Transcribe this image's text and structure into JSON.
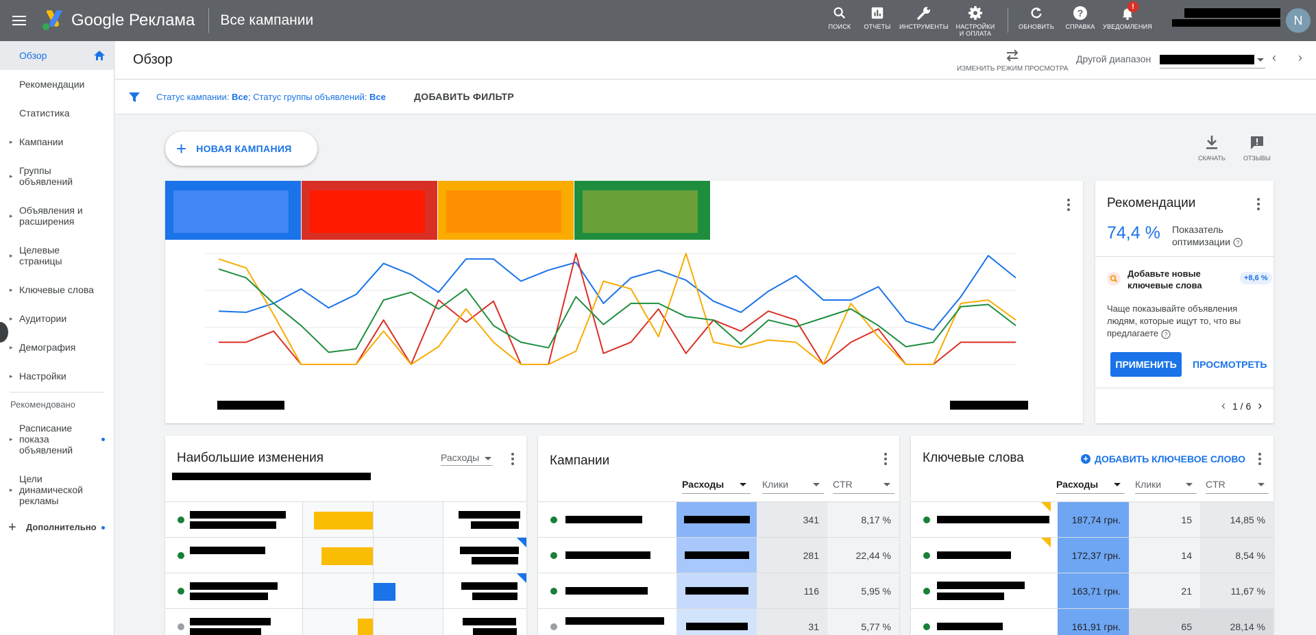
{
  "topbar": {
    "brand": "Google Реклама",
    "title": "Все кампании",
    "actions": [
      {
        "icon": "search-icon",
        "label": "ПОИСК"
      },
      {
        "icon": "reports-icon",
        "label": "ОТЧЕТЫ"
      },
      {
        "icon": "wrench-icon",
        "label": "ИНСТРУМЕНТЫ"
      },
      {
        "icon": "gear-icon",
        "label": "НАСТРОЙКИ И ОПЛАТА"
      },
      {
        "icon": "refresh-icon",
        "label": "ОБНОВИТЬ"
      },
      {
        "icon": "help-icon",
        "label": "СПРАВКА"
      },
      {
        "icon": "bell-icon",
        "label": "УВЕДОМЛЕНИЯ"
      }
    ],
    "notification_badge": "!",
    "avatar_letter": "N"
  },
  "sidebar": {
    "items": [
      {
        "label": "Обзор",
        "active": true
      },
      {
        "label": "Рекомендации"
      },
      {
        "label": "Статистика"
      },
      {
        "label": "Кампании"
      },
      {
        "label": "Группы объявлений"
      },
      {
        "label": "Объявления и расширения"
      },
      {
        "label": "Целевые страницы"
      },
      {
        "label": "Ключевые слова"
      },
      {
        "label": "Аудитории"
      },
      {
        "label": "Демография"
      },
      {
        "label": "Настройки"
      }
    ],
    "recommended_heading": "Рекомендовано",
    "recommended": [
      {
        "label": "Расписание показа объявлений"
      },
      {
        "label": "Цели динамической рекламы"
      }
    ],
    "more": "Дополнительно"
  },
  "header": {
    "title": "Обзор",
    "view_switch": "ИЗМЕНИТЬ РЕЖИМ ПРОСМОТРА",
    "range_label": "Другой диапазон"
  },
  "filter": {
    "campaign_status_label": "Статус кампании: ",
    "campaign_status_value": "Все",
    "sep": "; ",
    "group_status_label": "Статус группы объявлений: ",
    "group_status_value": "Все",
    "add_filter": "ДОБАВИТЬ ФИЛЬТР"
  },
  "new_campaign": "НОВАЯ КАМПАНИЯ",
  "utils": {
    "download": "СКАЧАТЬ",
    "feedback": "ОТЗЫВЫ"
  },
  "colors": {
    "blue": "#1a73e8",
    "red": "#d93025",
    "yellow": "#f9ab00",
    "green": "#1e8e3e"
  },
  "chart_data": {
    "type": "line",
    "series": [
      {
        "color": "#1a73e8",
        "values": [
          48,
          47,
          55,
          68,
          51,
          63,
          91,
          81,
          65,
          95,
          95,
          75,
          85,
          92,
          55,
          78,
          85,
          76,
          57,
          47,
          66,
          80,
          58,
          58,
          70,
          39,
          31,
          61,
          98,
          78
        ]
      },
      {
        "color": "#d93025",
        "values": [
          20,
          20,
          30,
          0,
          0,
          0,
          40,
          0,
          58,
          38,
          57,
          0,
          0,
          100,
          10,
          20,
          50,
          10,
          40,
          30,
          48,
          40,
          0,
          20,
          32,
          0,
          0,
          20,
          20,
          20
        ]
      },
      {
        "color": "#f9ab00",
        "values": [
          95,
          87,
          45,
          0,
          0,
          0,
          30,
          0,
          16,
          50,
          20,
          0,
          0,
          12,
          75,
          68,
          25,
          100,
          20,
          15,
          22,
          20,
          0,
          55,
          25,
          0,
          0,
          55,
          58,
          40
        ]
      },
      {
        "color": "#1e8e3e",
        "values": [
          86,
          78,
          55,
          35,
          11,
          14,
          58,
          65,
          50,
          68,
          35,
          20,
          15,
          61,
          36,
          55,
          55,
          43,
          40,
          18,
          40,
          34,
          42,
          50,
          35,
          16,
          20,
          52,
          54,
          35
        ]
      }
    ]
  },
  "recommendations": {
    "title": "Рекомендации",
    "score": "74,4 %",
    "score_label": "Показатель оптимизации",
    "item_title": "Добавьте новые ключевые слова",
    "item_gain": "+8,6 %",
    "item_desc": "Чаще показывайте объявления людям, которые ищут то, что вы предлагаете",
    "apply": "ПРИМЕНИТЬ",
    "view": "ПРОСМОТРЕТЬ",
    "pager": "1 / 6"
  },
  "changes": {
    "title": "Наибольшие изменения",
    "metric": "Расходы",
    "bars": [
      {
        "direction": "down",
        "amount": 0.9
      },
      {
        "direction": "down",
        "amount": 0.78
      },
      {
        "direction": "up",
        "amount": 0.33
      },
      {
        "direction": "down",
        "amount": 0.23
      }
    ]
  },
  "campaigns": {
    "title": "Кампании",
    "columns": [
      "Расходы",
      "Клики",
      "CTR"
    ],
    "rows": [
      {
        "clicks": "341",
        "ctr": "8,17 %",
        "status": "active",
        "shade": "#8ab4f8"
      },
      {
        "clicks": "281",
        "ctr": "22,44 %",
        "status": "active",
        "shade": "#a8c7fa"
      },
      {
        "clicks": "116",
        "ctr": "5,95 %",
        "status": "active",
        "shade": "#c6dafc"
      },
      {
        "clicks": "31",
        "ctr": "5,77 %",
        "status": "paused",
        "shade": "#d2e3fc"
      }
    ]
  },
  "keywords": {
    "title": "Ключевые слова",
    "add": "ДОБАВИТЬ КЛЮЧЕВОЕ СЛОВО",
    "columns": [
      "Расходы",
      "Клики",
      "CTR"
    ],
    "rows": [
      {
        "cost": "187,74 грн.",
        "clicks": "15",
        "ctr": "14,85 %"
      },
      {
        "cost": "172,37 грн.",
        "clicks": "14",
        "ctr": "8,54 %"
      },
      {
        "cost": "163,71 грн.",
        "clicks": "21",
        "ctr": "11,67 %"
      },
      {
        "cost": "161,91 грн.",
        "clicks": "65",
        "ctr": "28,14 %"
      }
    ]
  }
}
